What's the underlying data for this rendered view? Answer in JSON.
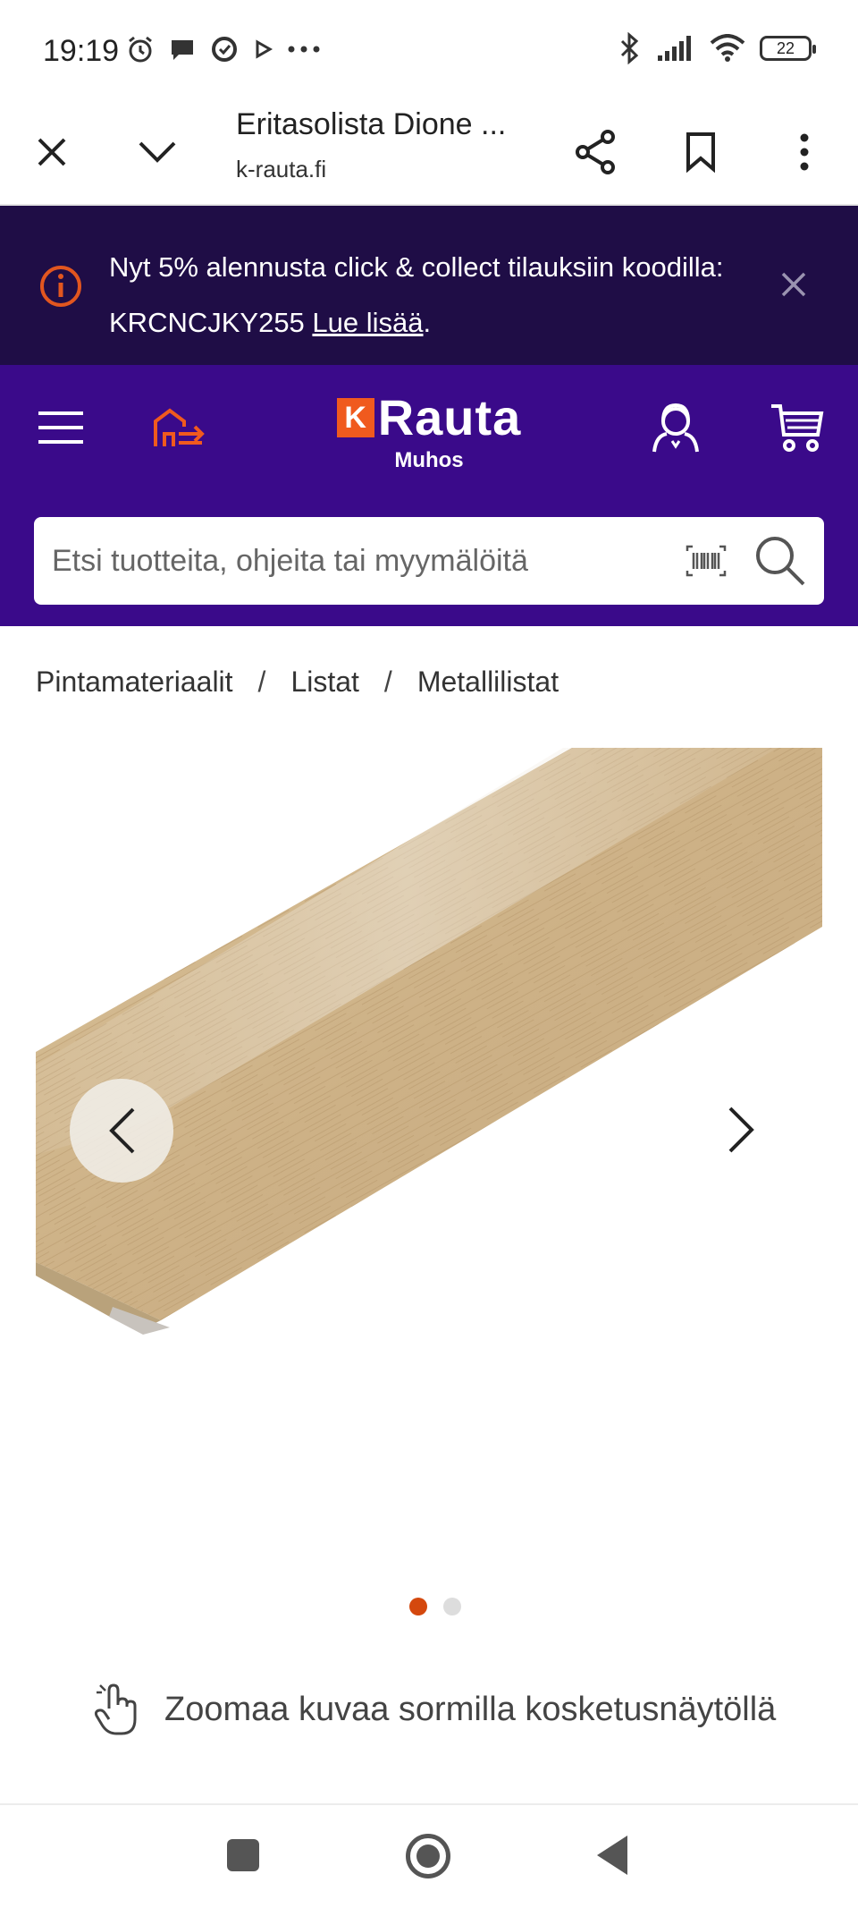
{
  "status_bar": {
    "time": "19:19",
    "battery": "22",
    "left_icons": [
      "alarm-icon",
      "chat-icon",
      "sync-icon",
      "play-icon",
      "more-dots-icon"
    ],
    "right_icons": [
      "bluetooth-icon",
      "signal-icon",
      "wifi-icon",
      "battery-icon"
    ]
  },
  "browser": {
    "page_title": "Eritasolista Dione ...",
    "url": "k-rauta.fi",
    "buttons": [
      "close-icon",
      "chevron-down-icon",
      "share-icon",
      "bookmark-icon",
      "more-vert-icon"
    ]
  },
  "promo": {
    "text_before": "Nyt 5% alennusta click & collect tilauksiin koodilla: KRCNCJKY255 ",
    "link": "Lue lisää",
    "text_after": ".",
    "accent_color": "#e2561f",
    "background": "#1f0d46"
  },
  "header": {
    "logo_k": "K",
    "logo_word": "Rauta",
    "store_name": "Muhos",
    "background": "#3a0a8a",
    "brand_orange": "#f05a1e"
  },
  "search": {
    "placeholder": "Etsi tuotteita, ohjeita tai myymälöitä"
  },
  "breadcrumb": {
    "items": [
      "Pintamateriaalit",
      "Listat",
      "Metallilistat"
    ],
    "separator": "/"
  },
  "gallery": {
    "image_count": 2,
    "active_index": 0,
    "image_description": "wood-texture transition strip"
  },
  "zoom_hint": {
    "text": "Zoomaa kuvaa sormilla kosketusnäytöllä"
  }
}
